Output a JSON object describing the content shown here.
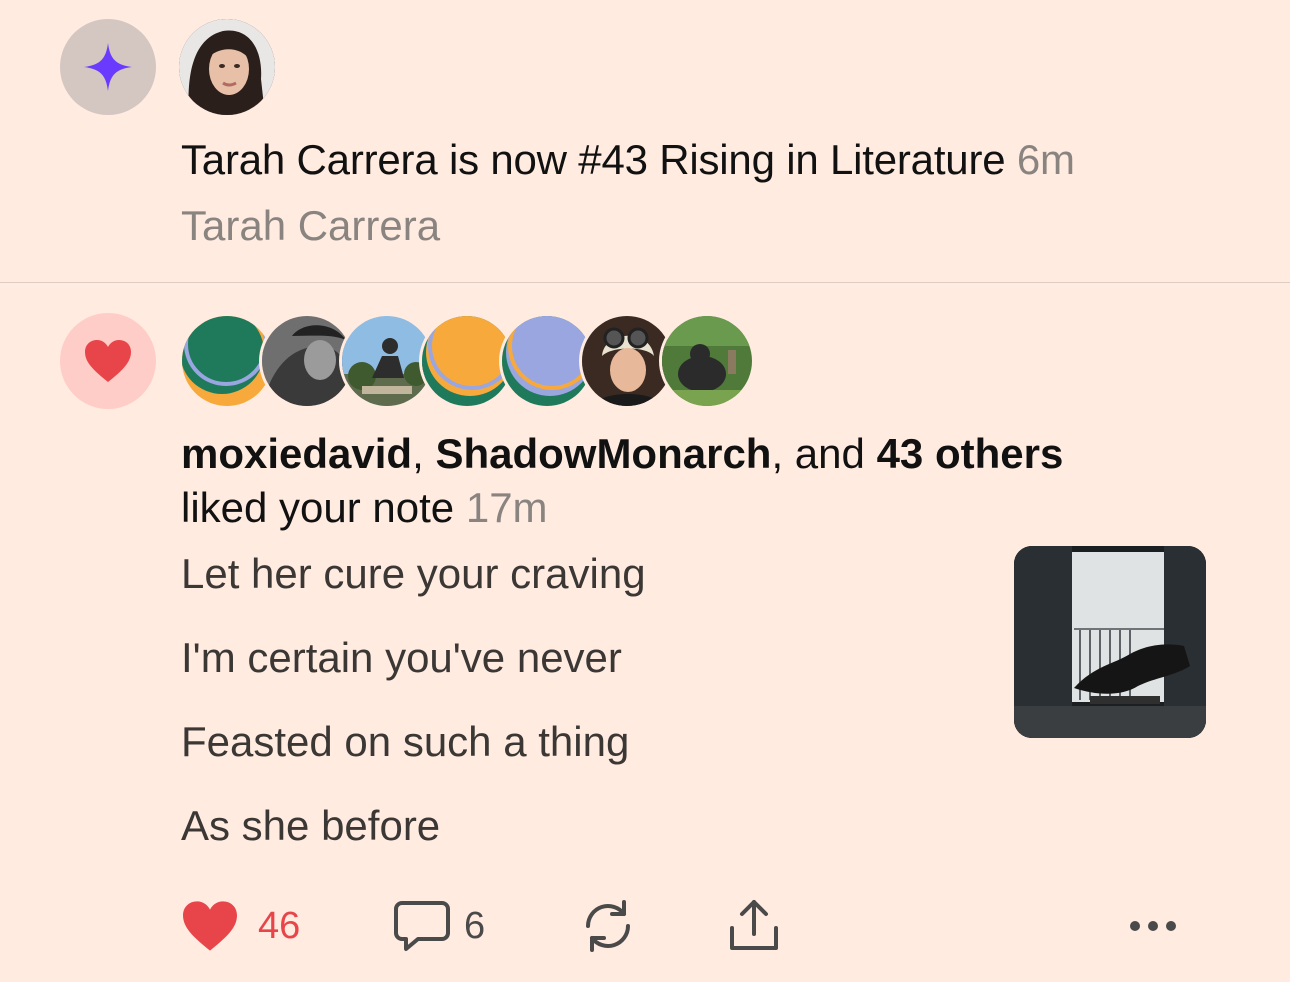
{
  "rising": {
    "headline": "Tarah Carrera is now #43 Rising in Literature",
    "time": "6m",
    "author": "Tarah Carrera"
  },
  "likes": {
    "user1": "moxiedavid",
    "sep1": ", ",
    "user2": "ShadowMonarch",
    "sep2": ", and ",
    "others": "43 others",
    "action": "liked your note",
    "time": "17m",
    "note_lines": [
      "Let her cure your craving",
      "I'm certain you've never",
      "Feasted on such a thing",
      "As she before"
    ],
    "like_count": "46",
    "comment_count": "6"
  },
  "colors": {
    "background": "#ffebe0",
    "accent_purple": "#6a3bff",
    "like_red": "#e8454b",
    "muted_text": "#8a8481"
  },
  "icons": {
    "rising": "sparkle-icon",
    "like": "heart-icon",
    "comment": "comment-icon",
    "restack": "restack-icon",
    "share": "share-icon",
    "more": "more-icon"
  }
}
